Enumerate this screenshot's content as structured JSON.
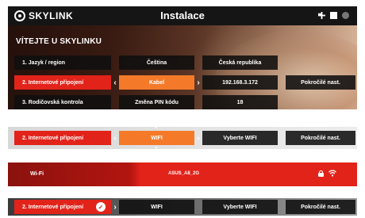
{
  "panel1": {
    "logo": "SKYLINK",
    "title": "Instalace",
    "welcome": "VÍTEJTE U SKYLINKU",
    "rows": [
      {
        "label": "1. Jazyk / region",
        "cells": [
          "Čeština",
          "Česká republika"
        ]
      },
      {
        "label": "2. Internetové připojení",
        "cells": [
          "Kabel",
          "192.168.3.172",
          "Pokročilé nast."
        ]
      },
      {
        "label": "3. Rodičovská kontrola",
        "cells": [
          "Změna PIN kódu",
          "18"
        ]
      }
    ],
    "left_arrow": "‹",
    "right_arrow": "›"
  },
  "panel2": {
    "label": "2. Internetové připojení",
    "mode": "WIFI",
    "select_wifi": "Vyberte WIFI",
    "advanced": "Pokročilé nast.",
    "left_arrow": "‹",
    "right_arrow": "›"
  },
  "panel3": {
    "label": "Wi-Fi",
    "ssid": "ASUS_A8_2G",
    "icons": [
      "lock-icon",
      "wifi-signal-icon"
    ]
  },
  "panel4": {
    "label": "2. Internetové připojení",
    "check": "✓",
    "mode": "WIFI",
    "select_wifi": "Vyberte WIFI",
    "advanced": "Pokročilé nast.",
    "right_arrow": "›"
  },
  "colors": {
    "red": "#e2231a",
    "orange": "#f47a2a",
    "dark": "#151515"
  }
}
